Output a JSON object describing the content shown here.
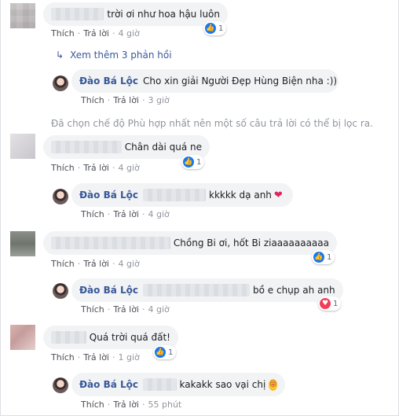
{
  "actions": {
    "like": "Thích",
    "reply": "Trả lời",
    "separator": "·"
  },
  "icons": {
    "like": "thumbs-up-icon",
    "love": "heart-icon",
    "reply_arrow": "reply-arrow-icon",
    "emoji": "tongue-emoji-icon"
  },
  "colors": {
    "name": "#385898",
    "bubble": "#f2f3f5",
    "like": "#1877f2",
    "love": "#f33e58",
    "heart": "#e0245e"
  },
  "page_name": "Đào Bá Lộc",
  "comments": [
    {
      "text": "trời ơi như hoa hậu luôn",
      "time": "4 giờ",
      "reactions": "1"
    },
    {
      "text": "Cho xin giải Người Đẹp Hùng Biện nha :))",
      "time": "3 giờ"
    },
    {
      "text": "Chân dài quá ne",
      "time": "4 giờ",
      "reactions": "1"
    },
    {
      "text": "kkkkk dạ anh",
      "time": "4 giờ",
      "heart": "❤"
    },
    {
      "text": "Chồng Bi ơi, hốt Bi ziaaaaaaaaaa",
      "time": "4 giờ",
      "reactions": "1"
    },
    {
      "text": "bồ e chụp ah anh",
      "time": "4 giờ",
      "reactions": "1"
    },
    {
      "text": "Quá trời quá đất!",
      "time": "1 giờ",
      "reactions": "1"
    },
    {
      "text": "kakakk sao vại chị",
      "time": "55 phút",
      "emoji": "😜"
    }
  ],
  "more_replies": "Xem thêm 3 phản hồi",
  "filter_notice": "Đã chọn chế độ Phù hợp nhất nên một số câu trả lời có thể bị lọc ra."
}
